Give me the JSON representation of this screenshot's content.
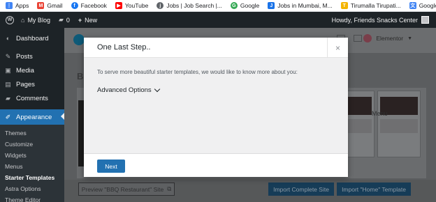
{
  "bookmarks": [
    {
      "icon": "apps-grid-icon",
      "label": "Apps",
      "color": "#4285f4"
    },
    {
      "icon": "gmail-icon",
      "label": "Gmail",
      "color": "#ea4335"
    },
    {
      "icon": "facebook-icon",
      "label": "Facebook",
      "color": "#1877f2"
    },
    {
      "icon": "youtube-icon",
      "label": "YouTube",
      "color": "#ff0000"
    },
    {
      "icon": "jobs-icon",
      "label": "Jobs | Job Search |...",
      "color": "#5f6368"
    },
    {
      "icon": "google-icon",
      "label": "Google",
      "color": "#34a853"
    },
    {
      "icon": "jobs-mumbai-icon",
      "label": "Jobs in Mumbai, M...",
      "color": "#1a73e8"
    },
    {
      "icon": "tirupati-icon",
      "label": "Tirumalla Tirupati...",
      "color": "#f4b400"
    },
    {
      "icon": "google-translate-icon",
      "label": "Google Translate",
      "color": "#4285f4"
    }
  ],
  "adminbar": {
    "site_name": "My Blog",
    "comments_count": "0",
    "new_label": "New",
    "greeting": "Howdy, Friends Snacks Center"
  },
  "sidebar": {
    "items": [
      {
        "icon": "dashboard-icon",
        "label": "Dashboard"
      },
      {
        "icon": "pin-icon",
        "label": "Posts"
      },
      {
        "icon": "media-icon",
        "label": "Media"
      },
      {
        "icon": "pages-icon",
        "label": "Pages"
      },
      {
        "icon": "comments-icon",
        "label": "Comments"
      },
      {
        "icon": "appearance-icon",
        "label": "Appearance"
      }
    ],
    "submenu": [
      "Themes",
      "Customize",
      "Widgets",
      "Menus",
      "Starter Templates",
      "Astra Options",
      "Theme Editor"
    ]
  },
  "background": {
    "elementor_label": "Elementor",
    "title_initial": "B",
    "thumb_label": "Menu",
    "preview_button": "Preview \"BBQ Restaurant\" Site",
    "import_complete_button": "Import Complete Site",
    "import_home_button": "Import \"Home\" Template"
  },
  "modal": {
    "title": "One Last Step..",
    "close_glyph": "×",
    "body_text": "To serve more beautiful starter templates, we would like to know more about you:",
    "advanced_options_label": "Advanced Options",
    "next_label": "Next"
  },
  "colors": {
    "accent": "#2271b1",
    "admin_bg": "#1d2327"
  }
}
